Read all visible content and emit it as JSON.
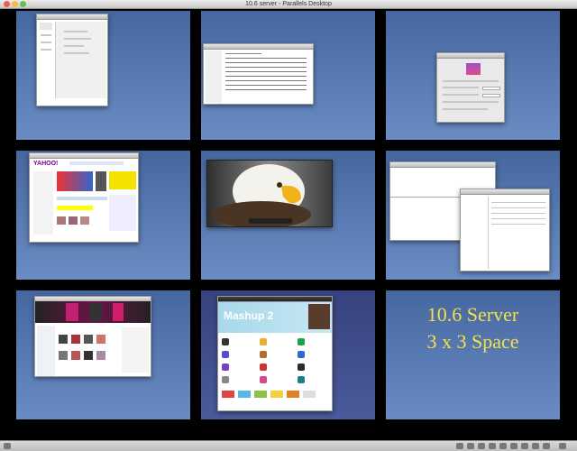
{
  "window": {
    "title": "10.6 server - Parallels Desktop",
    "close_color": "#f25b50",
    "minimize_color": "#f6bc3b",
    "zoom_color": "#5fc352"
  },
  "spaces_grid": {
    "rows": 3,
    "columns": 3,
    "desktop_color": "#5678b0",
    "label_lines": [
      "10.6 Server",
      "3 x 3 Space"
    ],
    "label_color": "#f2e14b"
  },
  "thumbnails": [
    {
      "name": "space-1",
      "content": "address-book-like window"
    },
    {
      "name": "space-2",
      "content": "file list window"
    },
    {
      "name": "space-3",
      "content": "system preferences window"
    },
    {
      "name": "space-4",
      "content": "Yahoo web page",
      "logo_text": "YAHOO!"
    },
    {
      "name": "space-5",
      "content": "video player with eagle"
    },
    {
      "name": "space-6",
      "content": "overlapping text windows"
    },
    {
      "name": "space-7",
      "content": "music store window"
    },
    {
      "name": "space-8",
      "content": "app store window",
      "banner_text": "Mashup 2"
    },
    {
      "name": "space-9",
      "content": "label"
    }
  ],
  "statusbar": {
    "icons": [
      "settings-icon",
      "display-icon",
      "disk-icon",
      "network-icon",
      "usb-icon",
      "sound-icon",
      "printer-icon",
      "camera-icon",
      "shared-folder-icon",
      "keyboard-icon",
      "lock-icon"
    ]
  }
}
